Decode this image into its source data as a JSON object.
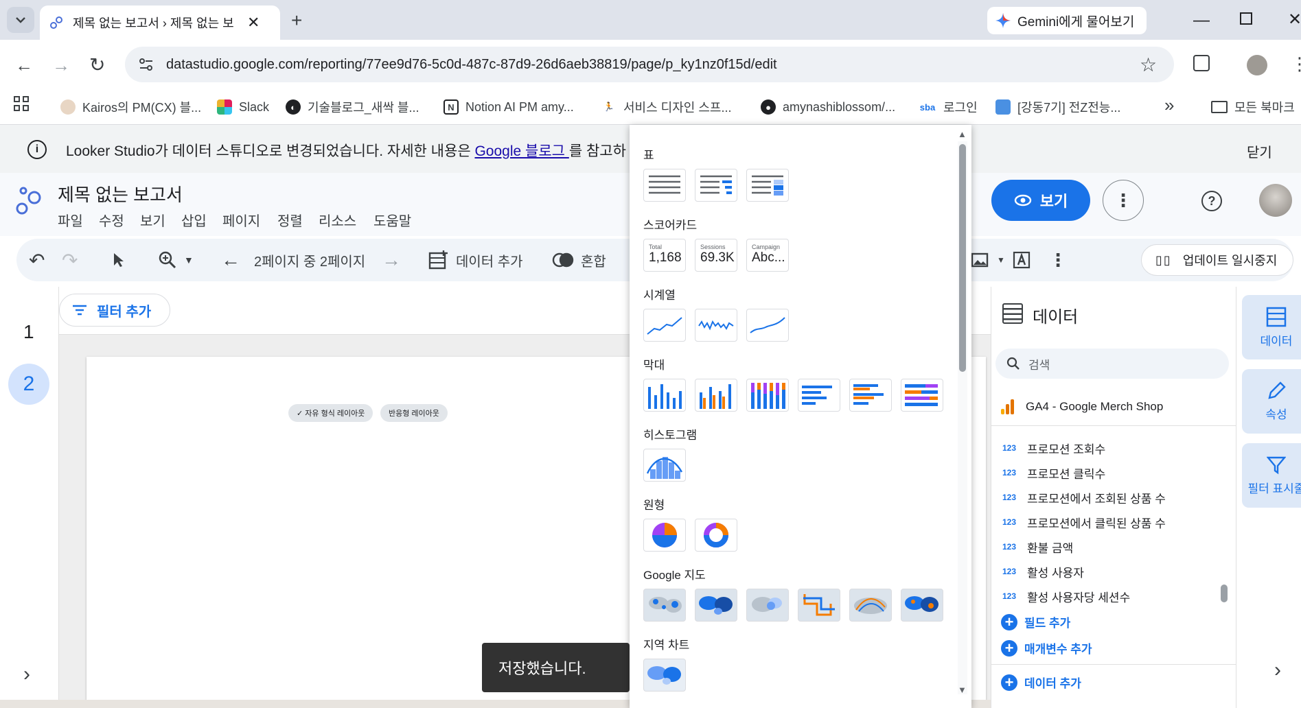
{
  "browser": {
    "tab_title": "제목 없는 보고서 › 제목 없는 보",
    "gemini_button": "Gemini에게 물어보기",
    "url": "datastudio.google.com/reporting/77ee9d76-5c0d-487c-87d9-26d6aeb38819/page/p_ky1nz0f15d/edit",
    "bookmarks": [
      {
        "label": "Kairos의 PM(CX) 블...",
        "icon": "notion-face-icon"
      },
      {
        "label": "Slack",
        "icon": "slack-icon"
      },
      {
        "label": "기술블로그_새싹 블...",
        "icon": "globe-icon"
      },
      {
        "label": "Notion AI PM amy...",
        "icon": "notion-icon"
      },
      {
        "label": "서비스 디자인 스프...",
        "icon": "runner-icon"
      },
      {
        "label": "amynashiblossom/...",
        "icon": "github-icon"
      },
      {
        "label": "로그인",
        "icon": "sba-icon"
      },
      {
        "label": "[강동7기] 전Z전능...",
        "icon": "laptop-icon"
      }
    ],
    "all_bookmarks": "모든 북마크"
  },
  "banner": {
    "text": "Looker Studio가 데이터 스튜디오로 변경되었습니다. 자세한 내용은 ",
    "link": "Google 블로그 ",
    "text_after": "를 참고하",
    "close": "닫기"
  },
  "app": {
    "title": "제목 없는 보고서",
    "menus": [
      "파일",
      "수정",
      "보기",
      "삽입",
      "페이지",
      "정렬",
      "리소스",
      "도움말"
    ],
    "view_button": "보기"
  },
  "toolbar": {
    "page_nav": "2페이지 중 2페이지",
    "add_data": "데이터 추가",
    "blend": "혼합",
    "pause_updates": "업데이트 일시중지"
  },
  "pages": {
    "items": [
      "1",
      "2"
    ],
    "active": "2"
  },
  "canvas": {
    "add_filter": "필터 추가",
    "layout_free": "✓ 자유 형식 레이아웃",
    "layout_responsive": "반응형 레이아웃"
  },
  "chart_picker": {
    "sections": [
      "표",
      "스코어카드",
      "시계열",
      "막대",
      "히스토그램",
      "원형",
      "Google 지도",
      "지역 차트"
    ],
    "scorecards": [
      {
        "title": "Total",
        "value": "1,168"
      },
      {
        "title": "Sessions",
        "value": "69.3K"
      },
      {
        "title": "Campaign",
        "value": "Abc..."
      }
    ]
  },
  "data_panel": {
    "title": "데이터",
    "search_placeholder": "검색",
    "source": "GA4 - Google Merch Shop",
    "fields": [
      "프로모션 조회수",
      "프로모션 클릭수",
      "프로모션에서 조회된 상품 수",
      "프로모션에서 클릭된 상품 수",
      "환불 금액",
      "활성 사용자",
      "활성 사용자당 세션수"
    ],
    "field_type": "123",
    "add_field": "필드 추가",
    "add_param": "매개변수 추가",
    "add_data": "데이터 추가"
  },
  "rail": {
    "data": "데이터",
    "props": "속성",
    "filter": "필터 표시줄"
  },
  "toast": "저장했습니다.",
  "colors": {
    "accent": "#1a73e8",
    "orange": "#f57c00",
    "purple": "#a142f4"
  }
}
